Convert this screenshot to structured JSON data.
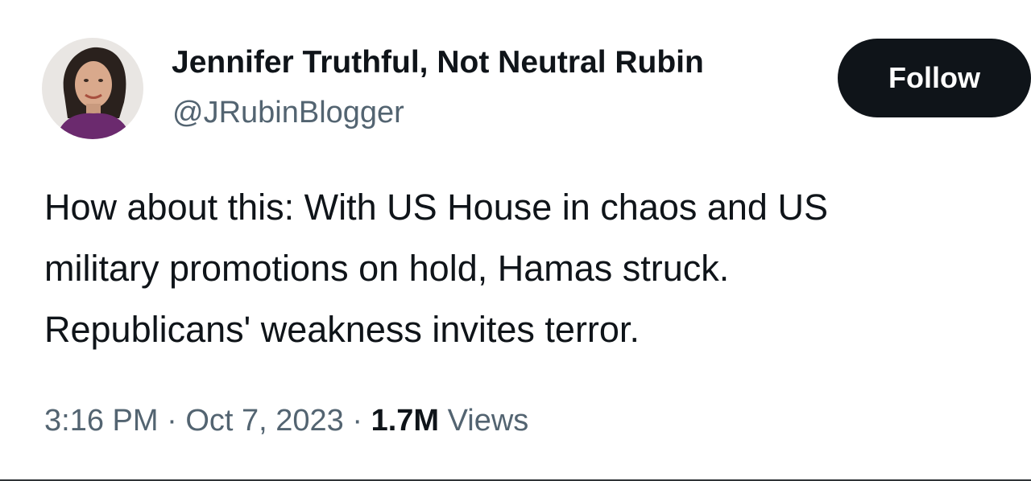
{
  "author": {
    "display_name": "Jennifer Truthful, Not Neutral Rubin",
    "handle": "@JRubinBlogger"
  },
  "follow_button_label": "Follow",
  "tweet": {
    "text_lines": [
      "How about this: With US House in chaos and US",
      "military promotions on hold, Hamas struck.",
      "Republicans' weakness invites terror."
    ]
  },
  "meta": {
    "time": "3:16 PM",
    "separator": " · ",
    "date": "Oct 7, 2023",
    "views_count": "1.7M",
    "views_label": " Views"
  },
  "colors": {
    "text_primary": "#0f1419",
    "text_secondary": "#536471",
    "button_bg": "#0f1419",
    "button_text": "#ffffff"
  }
}
